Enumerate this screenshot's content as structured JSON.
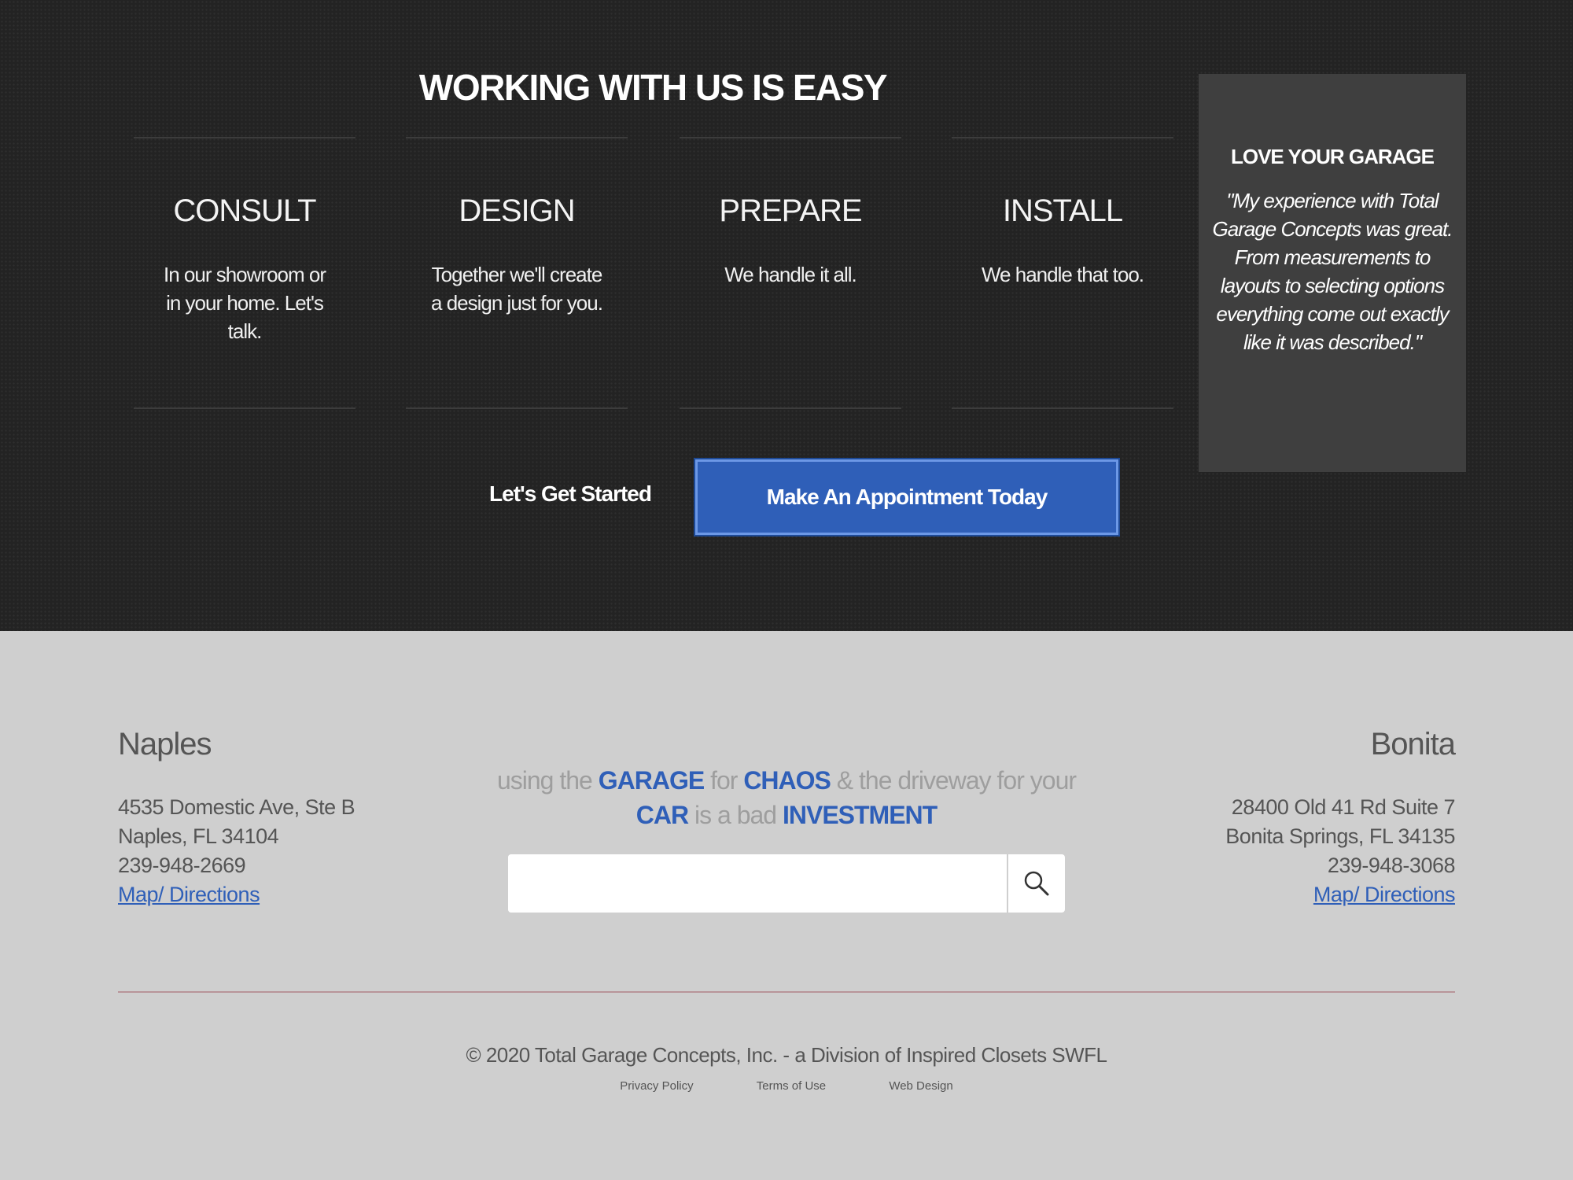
{
  "process": {
    "headline": "WORKING WITH US IS EASY",
    "steps": [
      {
        "title": "CONSULT",
        "description": "In our showroom or in your home. Let's talk."
      },
      {
        "title": "DESIGN",
        "description": "Together we'll create a design just for you."
      },
      {
        "title": "PREPARE",
        "description": "We handle it all."
      },
      {
        "title": "INSTALL",
        "description": "We handle that too."
      }
    ],
    "testimonial": {
      "title": "LOVE YOUR GARAGE",
      "quote": "\"My experience with Total Garage Concepts was great. From measurements to layouts to selecting options everything come out exactly like it was described.\""
    },
    "cta_label": "Let's Get Started",
    "cta_button": "Make An Appointment Today"
  },
  "footer": {
    "naples": {
      "name": "Naples",
      "address1": "4535 Domestic Ave, Ste B",
      "address2": "Naples, FL 34104",
      "phone": "239-948-2669",
      "map_link": "Map/ Directions"
    },
    "bonita": {
      "name": "Bonita",
      "address1": "28400 Old 41 Rd Suite 7",
      "address2": "Bonita Springs, FL 34135",
      "phone": "239-948-3068",
      "map_link": "Map/ Directions"
    },
    "slogan": {
      "w1": "using the",
      "garage": "GARAGE",
      "w2": "for",
      "chaos": "CHAOS",
      "w3": "& the driveway for your",
      "car": "CAR",
      "w4": "is a bad",
      "investment": "INVESTMENT"
    },
    "search": {
      "value": "",
      "icon": "search-icon"
    },
    "copyright": "© 2020 Total Garage Concepts, Inc. - a Division of Inspired Closets SWFL",
    "links": {
      "privacy": "Privacy Policy",
      "terms": "Terms of Use",
      "design": "Web Design"
    },
    "colors": {
      "accent": "#2f5fb8",
      "dark_bg": "#232323",
      "light_bg": "#cfcfcf"
    }
  }
}
